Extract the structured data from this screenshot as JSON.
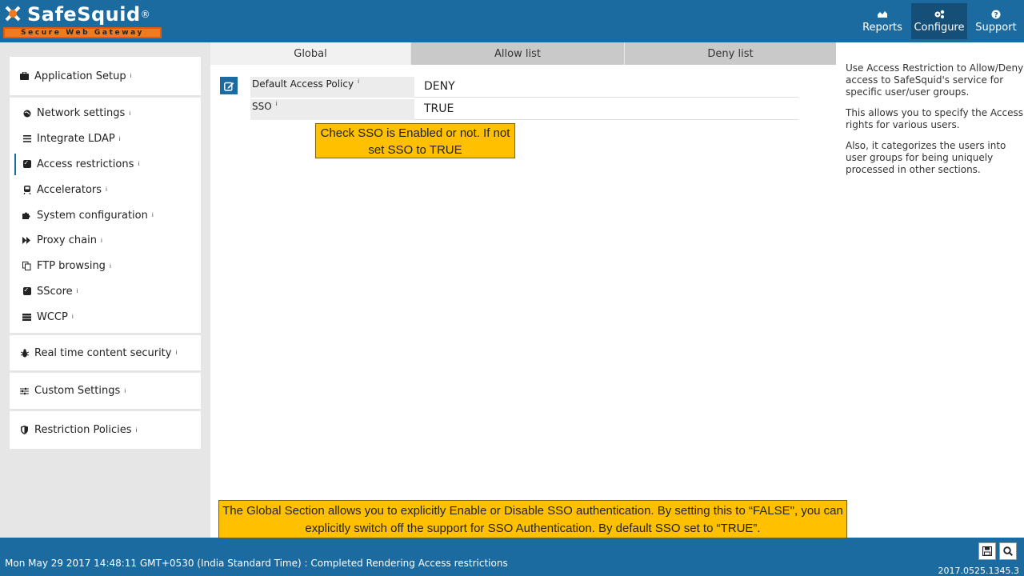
{
  "header": {
    "logo_name": "SafeSquid",
    "logo_reg": "®",
    "logo_tagline": "Secure Web Gateway",
    "nav": [
      {
        "label": "Reports",
        "icon": "chart-icon",
        "active": false
      },
      {
        "label": "Configure",
        "icon": "gears-icon",
        "active": true
      },
      {
        "label": "Support",
        "icon": "question-icon",
        "active": false
      }
    ]
  },
  "sidebar": {
    "application_setup": "Application Setup",
    "items": [
      {
        "label": "Network settings",
        "icon": "globe-icon"
      },
      {
        "label": "Integrate LDAP",
        "icon": "list-icon"
      },
      {
        "label": "Access restrictions",
        "icon": "checkbox-icon"
      },
      {
        "label": "Accelerators",
        "icon": "train-icon"
      },
      {
        "label": "System configuration",
        "icon": "puzzle-icon"
      },
      {
        "label": "Proxy chain",
        "icon": "forward-icon"
      },
      {
        "label": "FTP browsing",
        "icon": "copy-icon"
      },
      {
        "label": "SScore",
        "icon": "checkbox-icon"
      },
      {
        "label": "WCCP",
        "icon": "server-icon"
      }
    ],
    "realtime": "Real time content security",
    "custom": "Custom Settings",
    "restriction": "Restriction Policies",
    "info": "i"
  },
  "tabs": [
    "Global",
    "Allow list",
    "Deny list"
  ],
  "fields": [
    {
      "label": "Default Access Policy",
      "value": "DENY"
    },
    {
      "label": "SSO",
      "value": "TRUE"
    }
  ],
  "callout_top": "Check SSO is Enabled or not. If not set SSO to TRUE",
  "callout_bottom": "The Global Section allows you to explicitly Enable or Disable SSO authentication. By setting this to “FALSE\", you can explicitly switch off the support for SSO Authentication. By default SSO set to “TRUE”.",
  "help": [
    "Use Access Restriction to Allow/Deny access to SafeSquid's service for specific user/user groups.",
    "This allows you to specify the Access rights for various users.",
    "Also, it categorizes the users into user groups for being uniquely processed in other sections."
  ],
  "status": {
    "message": "Mon May 29 2017 14:48:11 GMT+0530 (India Standard Time) : Completed Rendering Access restrictions",
    "version": "2017.0525.1345.3"
  }
}
